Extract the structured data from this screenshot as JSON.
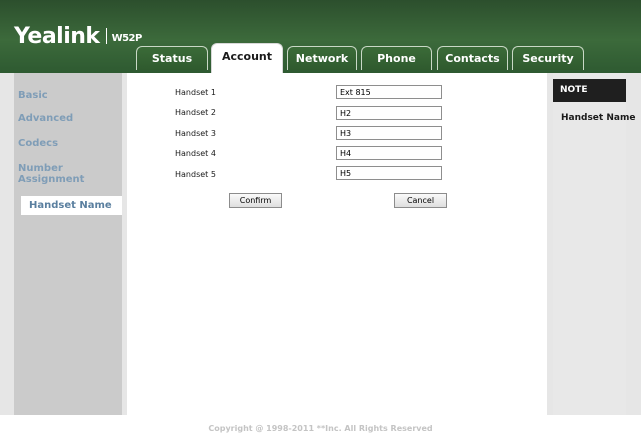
{
  "brand": {
    "name": "Yealink",
    "model": "W52P"
  },
  "tabs": [
    {
      "label": "Status"
    },
    {
      "label": "Account"
    },
    {
      "label": "Network"
    },
    {
      "label": "Phone"
    },
    {
      "label": "Contacts"
    },
    {
      "label": "Security"
    }
  ],
  "active_tab": "Account",
  "sidebar": {
    "items": [
      {
        "label": "Basic"
      },
      {
        "label": "Advanced"
      },
      {
        "label": "Codecs"
      },
      {
        "label": "Number"
      },
      {
        "label": "Assignment"
      },
      {
        "label": "Handset Name"
      }
    ],
    "active": "Handset Name"
  },
  "form": {
    "rows": [
      {
        "label": "Handset 1",
        "value": "Ext 815"
      },
      {
        "label": "Handset 2",
        "value": "H2"
      },
      {
        "label": "Handset 3",
        "value": "H3"
      },
      {
        "label": "Handset 4",
        "value": "H4"
      },
      {
        "label": "Handset 5",
        "value": "H5"
      }
    ],
    "confirm_label": "Confirm",
    "cancel_label": "Cancel"
  },
  "note": {
    "header": "NOTE",
    "title": "Handset Name"
  },
  "footer": "Copyright @ 1998-2011 **Inc. All Rights Reserved",
  "colors": {
    "header_green": "#3c6a3b",
    "nav_text": "#7f9db7",
    "sidebar_bg": "#cbcbcb",
    "note_header": "#1f1f1f"
  }
}
